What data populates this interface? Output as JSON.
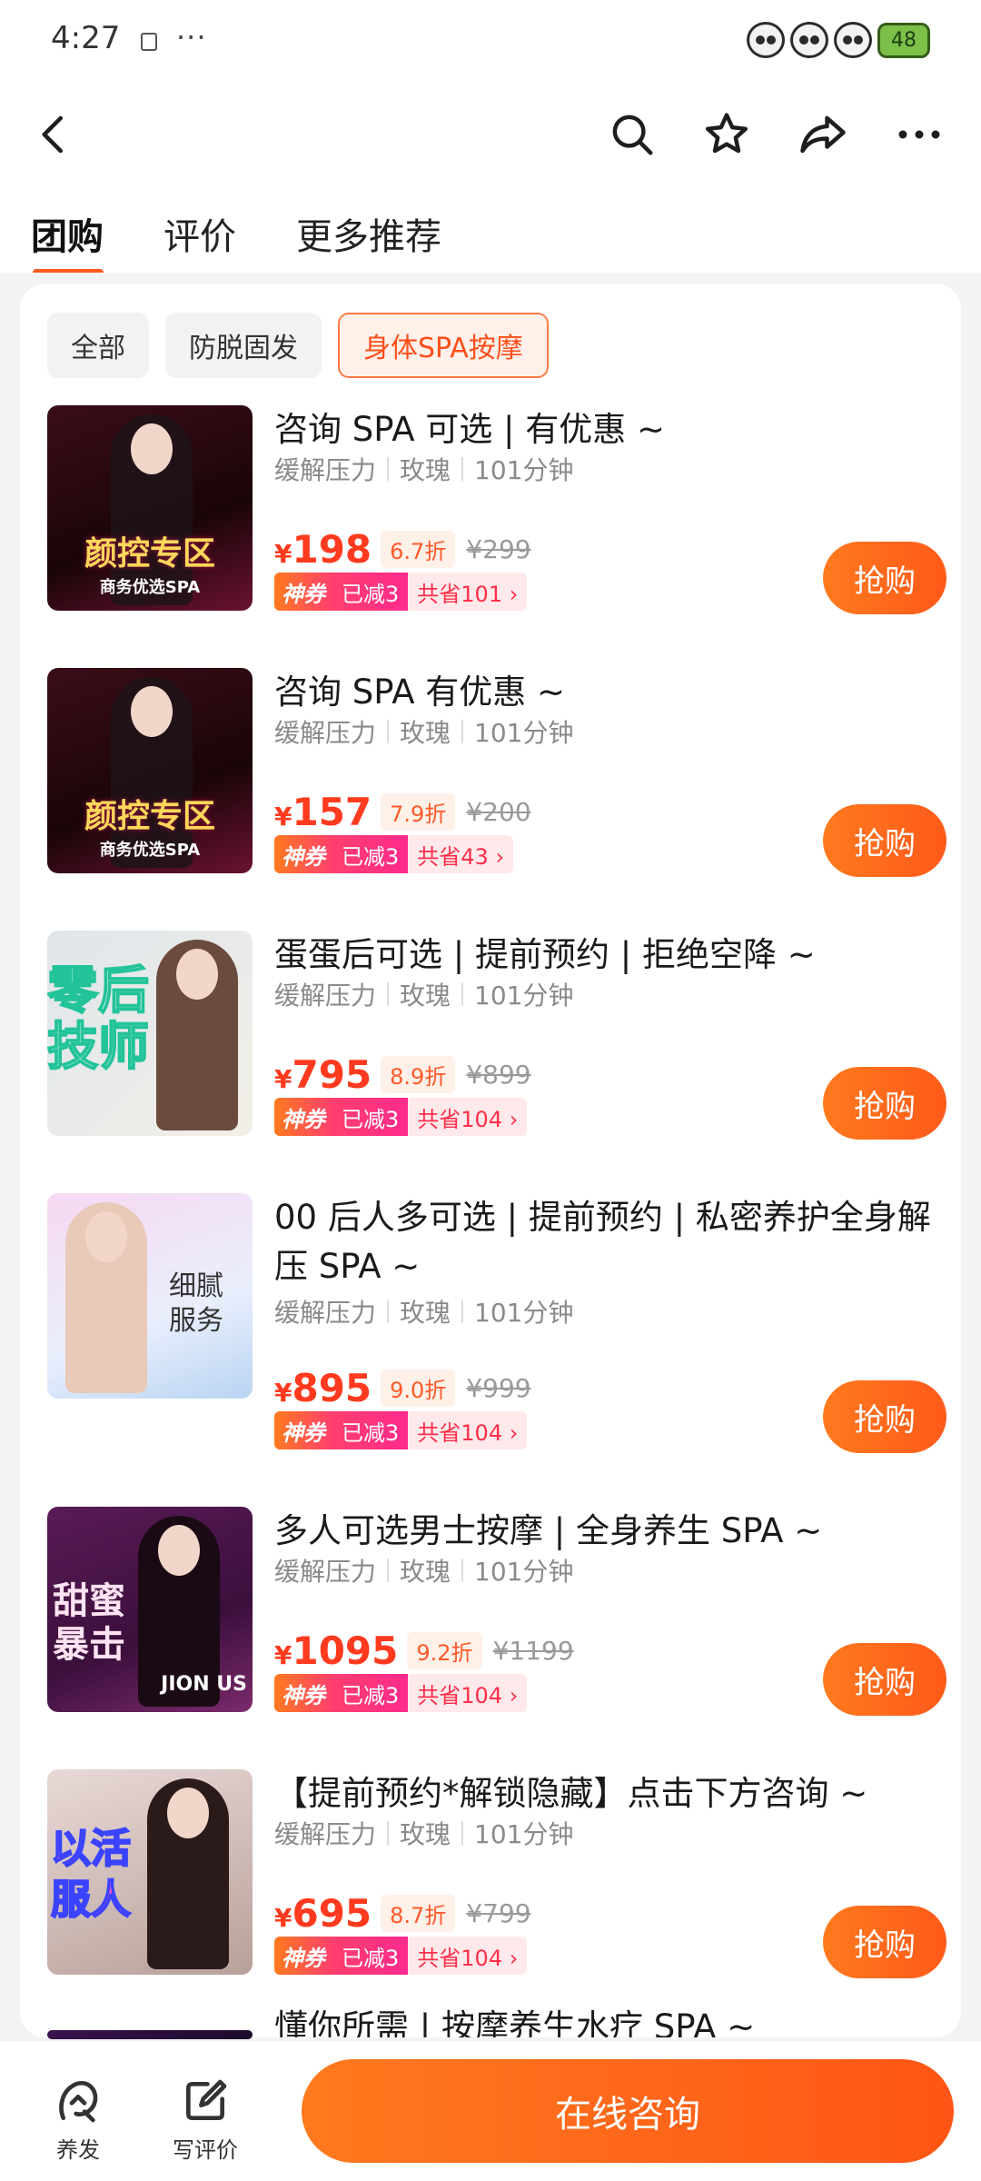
{
  "status_bar": {
    "time": "4:27",
    "more": "···",
    "battery": "48"
  },
  "tabs": [
    {
      "label": "团购"
    },
    {
      "label": "评价"
    },
    {
      "label": "更多推荐"
    }
  ],
  "filters": [
    {
      "label": "全部"
    },
    {
      "label": "防脱固发"
    },
    {
      "label": "身体SPA按摩"
    }
  ],
  "deals": [
    {
      "title": "咨询 SPA 可选 | 有优惠 ~",
      "tags": [
        "缓解压力",
        "玫瑰",
        "101分钟"
      ],
      "price_symbol": "¥",
      "price": "198",
      "discount": "6.7折",
      "original": "¥299",
      "coupon_a": "神券",
      "coupon_b": "已减3",
      "coupon_c": "共省101 ›",
      "buy": "抢购",
      "thumb_main": "颜控专区",
      "thumb_sub": "商务优选SPA"
    },
    {
      "title": "咨询 SPA 有优惠 ~",
      "tags": [
        "缓解压力",
        "玫瑰",
        "101分钟"
      ],
      "price_symbol": "¥",
      "price": "157",
      "discount": "7.9折",
      "original": "¥200",
      "coupon_a": "神券",
      "coupon_b": "已减3",
      "coupon_c": "共省43 ›",
      "buy": "抢购",
      "thumb_main": "颜控专区",
      "thumb_sub": "商务优选SPA"
    },
    {
      "title": "蛋蛋后可选 | 提前预约 | 拒绝空降 ~",
      "tags": [
        "缓解压力",
        "玫瑰",
        "101分钟"
      ],
      "price_symbol": "¥",
      "price": "795",
      "discount": "8.9折",
      "original": "¥899",
      "coupon_a": "神券",
      "coupon_b": "已减3",
      "coupon_c": "共省104 ›",
      "buy": "抢购",
      "thumb_main": "零后技师"
    },
    {
      "title": "00 后人多可选 | 提前预约 | 私密养护全身解压 SPA ~",
      "tags": [
        "缓解压力",
        "玫瑰",
        "101分钟"
      ],
      "price_symbol": "¥",
      "price": "895",
      "discount": "9.0折",
      "original": "¥999",
      "coupon_a": "神券",
      "coupon_b": "已减3",
      "coupon_c": "共省104 ›",
      "buy": "抢购",
      "thumb_main": "细腻服务"
    },
    {
      "title": "多人可选男士按摩 | 全身养生 SPA ~",
      "tags": [
        "缓解压力",
        "玫瑰",
        "101分钟"
      ],
      "price_symbol": "¥",
      "price": "1095",
      "discount": "9.2折",
      "original": "¥1199",
      "coupon_a": "神券",
      "coupon_b": "已减3",
      "coupon_c": "共省104 ›",
      "buy": "抢购",
      "thumb_main": "甜蜜暴击",
      "thumb_sub": "JION US"
    },
    {
      "title": "【提前预约*解锁隐藏】点击下方咨询 ~",
      "tags": [
        "缓解压力",
        "玫瑰",
        "101分钟"
      ],
      "price_symbol": "¥",
      "price": "695",
      "discount": "8.7折",
      "original": "¥799",
      "coupon_a": "神券",
      "coupon_b": "已减3",
      "coupon_c": "共省104 ›",
      "buy": "抢购",
      "thumb_main": "以活服人"
    },
    {
      "title": "懂你所需 | 按摩养生水疗 SPA ~"
    }
  ],
  "bottom": {
    "left_label": "养发",
    "review_label": "写评价",
    "consult": "在线咨询"
  }
}
